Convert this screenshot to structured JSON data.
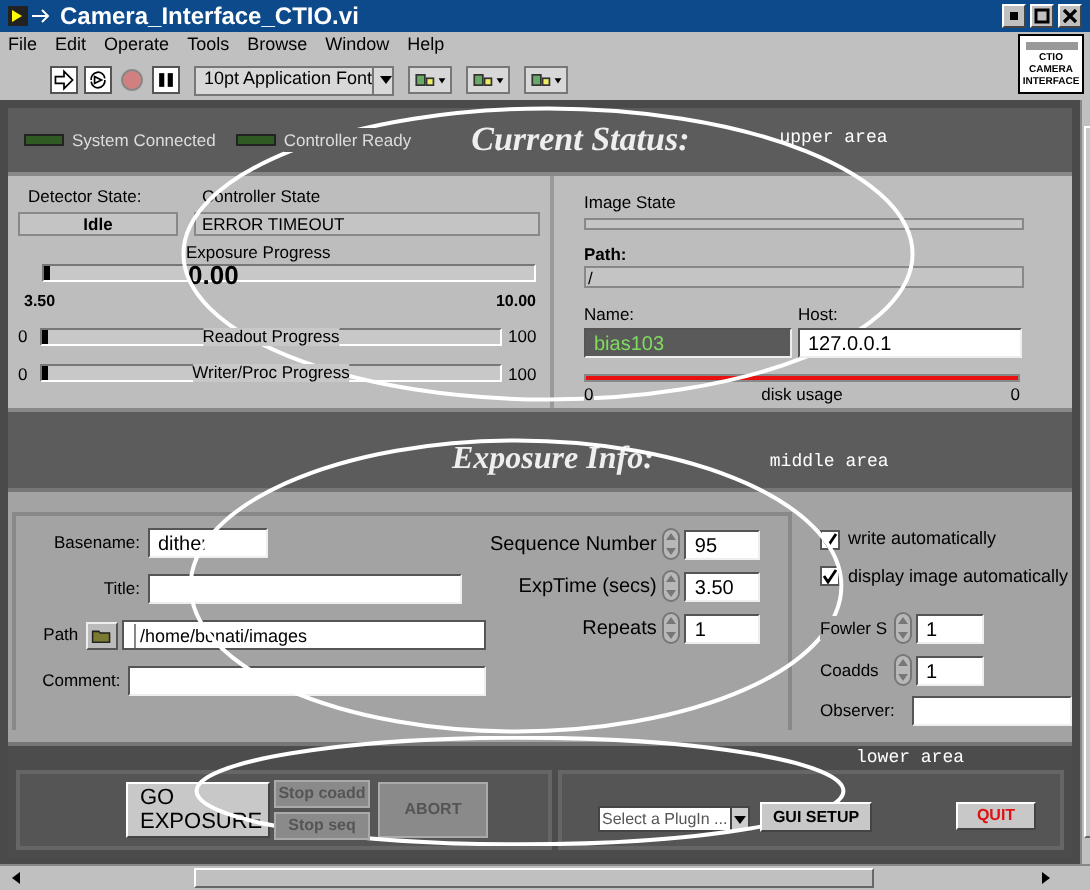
{
  "window": {
    "title": "Camera_Interface_CTIO.vi"
  },
  "menu": [
    "File",
    "Edit",
    "Operate",
    "Tools",
    "Browse",
    "Window",
    "Help"
  ],
  "toolbar": {
    "font": "10pt Application Font",
    "running": false
  },
  "vi_icon": [
    "CTIO",
    "CAMERA",
    "INTERFACE"
  ],
  "leds": [
    {
      "label": "System Connected",
      "on": false
    },
    {
      "label": "Controller Ready",
      "on": false
    }
  ],
  "status": {
    "heading": "Current Status:",
    "annotation": "upper area",
    "detector": {
      "label": "Detector State:",
      "value": "Idle"
    },
    "controller": {
      "label": "Controller State",
      "value": "ERROR TIMEOUT"
    },
    "exposure": {
      "label": "Exposure Progress",
      "value": "0.00",
      "min": "3.50",
      "max": "10.00",
      "level": 0
    },
    "bars": [
      {
        "label": "Readout Progress",
        "min": "0",
        "max": "100",
        "level": 0
      },
      {
        "label": "Writer/Proc Progress",
        "min": "0",
        "max": "100",
        "level": 0
      }
    ],
    "image_state": {
      "label": "Image State"
    },
    "path": {
      "label": "Path:",
      "value": "/"
    },
    "name": {
      "label": "Name:",
      "value": "bias103"
    },
    "host": {
      "label": "Host:",
      "value": "127.0.0.1"
    },
    "disk": {
      "label": "disk usage",
      "min": "0",
      "max": "0",
      "level": 1
    }
  },
  "exposure_info": {
    "heading": "Exposure Info:",
    "annotation": "middle area",
    "basename": {
      "label": "Basename:",
      "value": "dither"
    },
    "title": {
      "label": "Title:"
    },
    "path": {
      "label": "Path",
      "value": "/home/bonati/images"
    },
    "comment": {
      "label": "Comment:"
    },
    "sequence": {
      "label": "Sequence Number",
      "value": "95"
    },
    "exptime": {
      "label": "ExpTime (secs)",
      "value": "3.50"
    },
    "repeats": {
      "label": "Repeats",
      "value": "1"
    },
    "checks": [
      {
        "label": "write automatically",
        "checked": true
      },
      {
        "label": "display image automatically",
        "checked": true
      }
    ],
    "fowler": {
      "label": "Fowler S",
      "value": "1"
    },
    "coadds": {
      "label": "Coadds",
      "value": "1"
    },
    "observer": {
      "label": "Observer:"
    }
  },
  "controls": {
    "annotation": "lower area",
    "go": "GO EXPOSURE",
    "stop_coadd": "Stop coadd",
    "stop_seq": "Stop seq",
    "abort": "ABORT",
    "plugin": {
      "placeholder": "Select a PlugIn ..."
    },
    "gui_setup": "GUI SETUP",
    "quit": "QUIT"
  }
}
